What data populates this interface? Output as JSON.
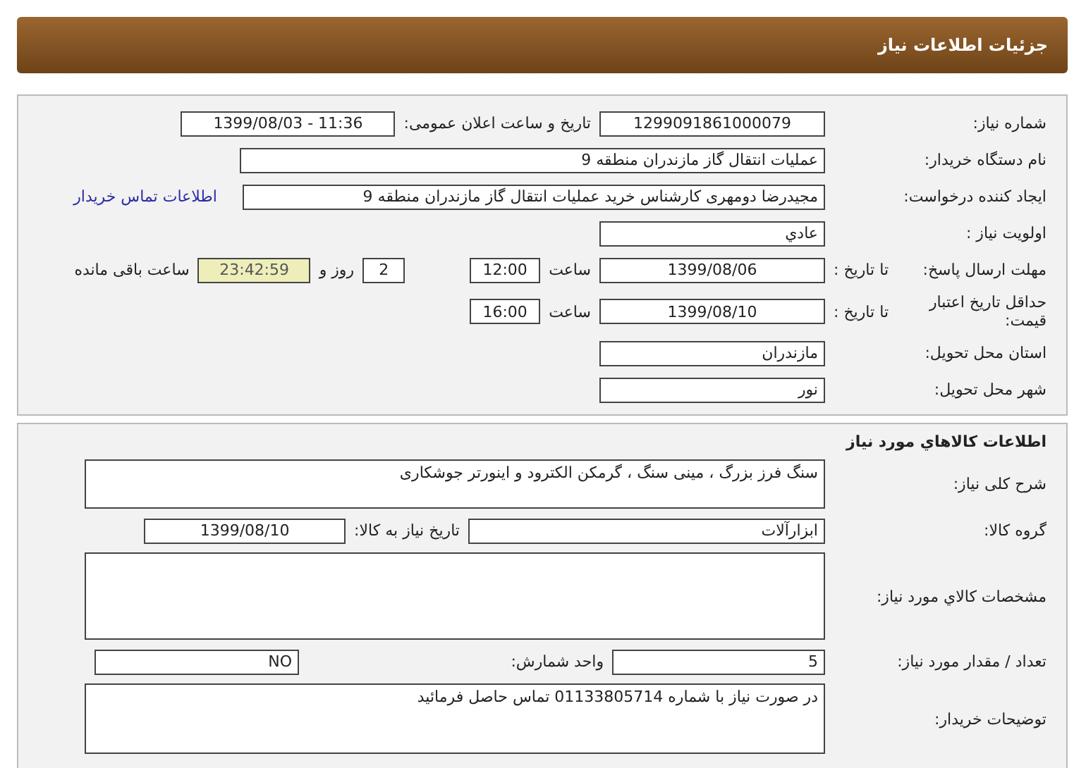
{
  "header": {
    "title": "جزئیات اطلاعات نیاز"
  },
  "general": {
    "need_number": {
      "label": "شماره نیاز:",
      "value": "1299091861000079"
    },
    "announce": {
      "label": "تاریخ و ساعت اعلان عمومی:",
      "value": "1399/08/03 - 11:36"
    },
    "buyer": {
      "label": "نام دستگاه خریدار:",
      "value": "عملیات انتقال گاز مازندران منطقه 9"
    },
    "requester": {
      "label": "ایجاد کننده درخواست:",
      "value": "مجیدرضا دومهری کارشناس خرید عملیات انتقال گاز مازندران منطقه 9",
      "link": "اطلاعات تماس خریدار"
    },
    "priority": {
      "label": "اولویت نیاز :",
      "value": "عادي"
    },
    "deadline": {
      "label": "مهلت ارسال پاسخ:",
      "sub_label": "تا تاریخ :",
      "date": "1399/08/06",
      "time_label": "ساعت",
      "time": "12:00",
      "days": "2",
      "days_label": "روز و",
      "remaining": "23:42:59",
      "remaining_label": "ساعت باقی مانده"
    },
    "validity": {
      "label": "حداقل تاریخ اعتبار قیمت:",
      "sub_label": "تا تاریخ :",
      "date": "1399/08/10",
      "time_label": "ساعت",
      "time": "16:00"
    },
    "province": {
      "label": "استان محل تحویل:",
      "value": "مازندران"
    },
    "city": {
      "label": "شهر محل تحویل:",
      "value": "نور"
    }
  },
  "goods": {
    "title": "اطلاعات کالاهاي مورد نياز",
    "description": {
      "label": "شرح کلی نیاز:",
      "value": "سنگ فرز بزرگ ، مینی سنگ ، گرمکن الکترود و اینورتر جوشکاری"
    },
    "group": {
      "label": "گروه کالا:",
      "value": "ابزارآلات",
      "date_label": "تاریخ نیاز به کالا:",
      "date": "1399/08/10"
    },
    "specs": {
      "label": "مشخصات کالاي مورد نياز:"
    },
    "quantity": {
      "label": "تعداد / مقدار مورد نیاز:",
      "value": "5",
      "unit_label": "واحد شمارش:",
      "unit": "NO"
    },
    "notes": {
      "label": "توضیحات خریدار:",
      "value": "در صورت نیاز با شماره 01133805714 تماس حاصل فرمائید"
    }
  }
}
